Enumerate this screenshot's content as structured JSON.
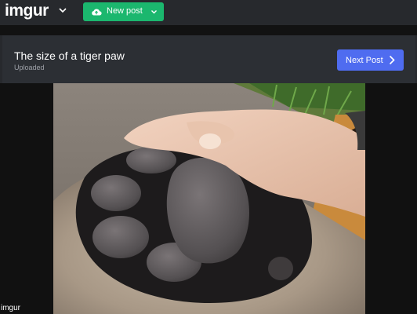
{
  "header": {
    "logo": "imgur",
    "new_post_label": "New post"
  },
  "post": {
    "title": "The size of a tiger paw",
    "status": "Uploaded",
    "next_label": "Next Post"
  },
  "footer": {
    "watermark": "imgur"
  },
  "icons": {
    "logo_menu": "chevron-down-icon",
    "upload": "cloud-upload-icon",
    "new_post_menu": "chevron-down-icon",
    "next": "chevron-right-icon"
  },
  "colors": {
    "background": "#27292d",
    "new_post_button": "#1bb76e",
    "next_button": "#4f6cf0",
    "panel": "#2c2f34"
  }
}
